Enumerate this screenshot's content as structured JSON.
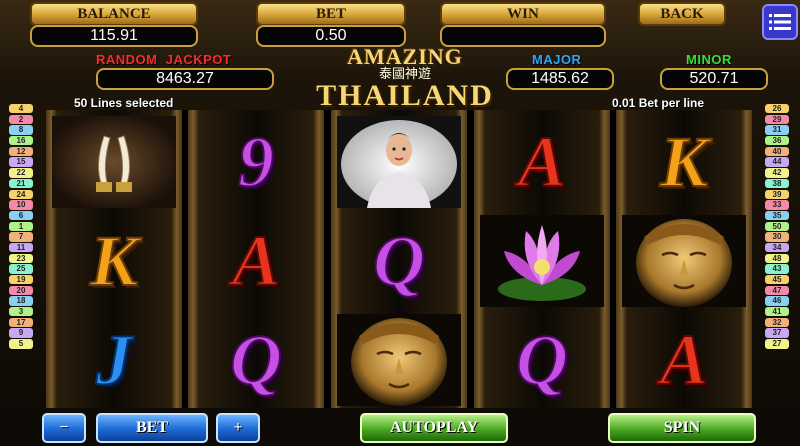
{
  "hud": {
    "balance_label": "BALANCE",
    "balance_value": "115.91",
    "bet_label": "BET",
    "bet_value": "0.50",
    "win_label": "WIN",
    "win_value": "",
    "back_label": "BACK"
  },
  "jackpots": {
    "random_label_1": "RANDOM",
    "random_label_2": "JACKPOT",
    "random_value": "8463.27",
    "major_label": "MAJOR",
    "major_value": "1485.62",
    "minor_label": "MINOR",
    "minor_value": "520.71"
  },
  "logo": {
    "line1": "AMAZING",
    "chinese": "泰國神遊",
    "line2": "THAILAND"
  },
  "info": {
    "lines_selected": "50 Lines selected",
    "bet_per_line": "0.01 Bet per line"
  },
  "left_lines": [
    "4",
    "2",
    "8",
    "16",
    "12",
    "15",
    "22",
    "21",
    "24",
    "10",
    "6",
    "1",
    "7",
    "11",
    "23",
    "25",
    "19",
    "20",
    "18",
    "3",
    "17",
    "9",
    "5"
  ],
  "right_lines": [
    "26",
    "29",
    "31",
    "36",
    "40",
    "44",
    "42",
    "38",
    "39",
    "33",
    "35",
    "50",
    "30",
    "34",
    "48",
    "43",
    "45",
    "47",
    "46",
    "41",
    "32",
    "37",
    "27"
  ],
  "reels": [
    [
      "tusks",
      "K",
      "J"
    ],
    [
      "9",
      "A",
      "Q"
    ],
    [
      "dancer",
      "Q",
      "buddha"
    ],
    [
      "A",
      "lotus",
      "Q"
    ],
    [
      "K",
      "buddha",
      "A"
    ]
  ],
  "controls": {
    "minus": "−",
    "bet": "BET",
    "plus": "+",
    "autoplay": "AUTOPLAY",
    "spin": "SPIN"
  },
  "colors": {
    "random_jackpot": "#ff2a2a",
    "major": "#27a9ff",
    "minor": "#32e232"
  }
}
